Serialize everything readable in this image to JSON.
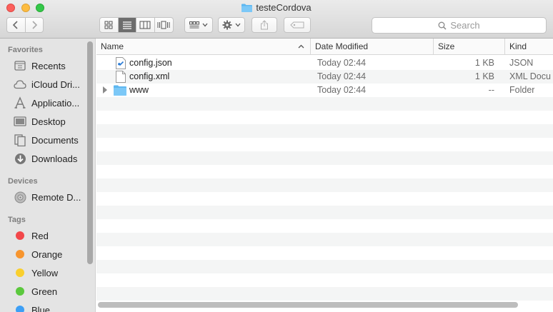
{
  "window": {
    "title": "testeCordova"
  },
  "toolbar": {
    "back_icon": "chevron-left-icon",
    "forward_icon": "chevron-right-icon",
    "view_modes": [
      "icon-view",
      "list-view",
      "column-view",
      "cover-flow-view"
    ],
    "active_view": "list-view",
    "search_placeholder": "Search"
  },
  "sidebar": {
    "favorites_title": "Favorites",
    "favorites": [
      {
        "label": "Recents",
        "icon": "recents-icon"
      },
      {
        "label": "iCloud Dri...",
        "icon": "cloud-icon"
      },
      {
        "label": "Applicatio...",
        "icon": "applications-icon"
      },
      {
        "label": "Desktop",
        "icon": "desktop-icon"
      },
      {
        "label": "Documents",
        "icon": "documents-icon"
      },
      {
        "label": "Downloads",
        "icon": "downloads-icon"
      }
    ],
    "devices_title": "Devices",
    "devices": [
      {
        "label": "Remote D...",
        "icon": "disc-icon"
      }
    ],
    "tags_title": "Tags",
    "tags": [
      {
        "label": "Red",
        "color": "#f2474a"
      },
      {
        "label": "Orange",
        "color": "#f7952e"
      },
      {
        "label": "Yellow",
        "color": "#f9cf2e"
      },
      {
        "label": "Green",
        "color": "#5bc83d"
      },
      {
        "label": "Blue",
        "color": "#3d9ff5"
      }
    ]
  },
  "columns": {
    "name": "Name",
    "date": "Date Modified",
    "size": "Size",
    "kind": "Kind"
  },
  "files": [
    {
      "name": "config.json",
      "date": "Today 02:44",
      "size": "1 KB",
      "kind": "JSON",
      "icon": "vscode-file-icon"
    },
    {
      "name": "config.xml",
      "date": "Today 02:44",
      "size": "1 KB",
      "kind": "XML Docu",
      "icon": "document-icon"
    },
    {
      "name": "www",
      "date": "Today 02:44",
      "size": "--",
      "kind": "Folder",
      "icon": "folder-icon"
    }
  ]
}
